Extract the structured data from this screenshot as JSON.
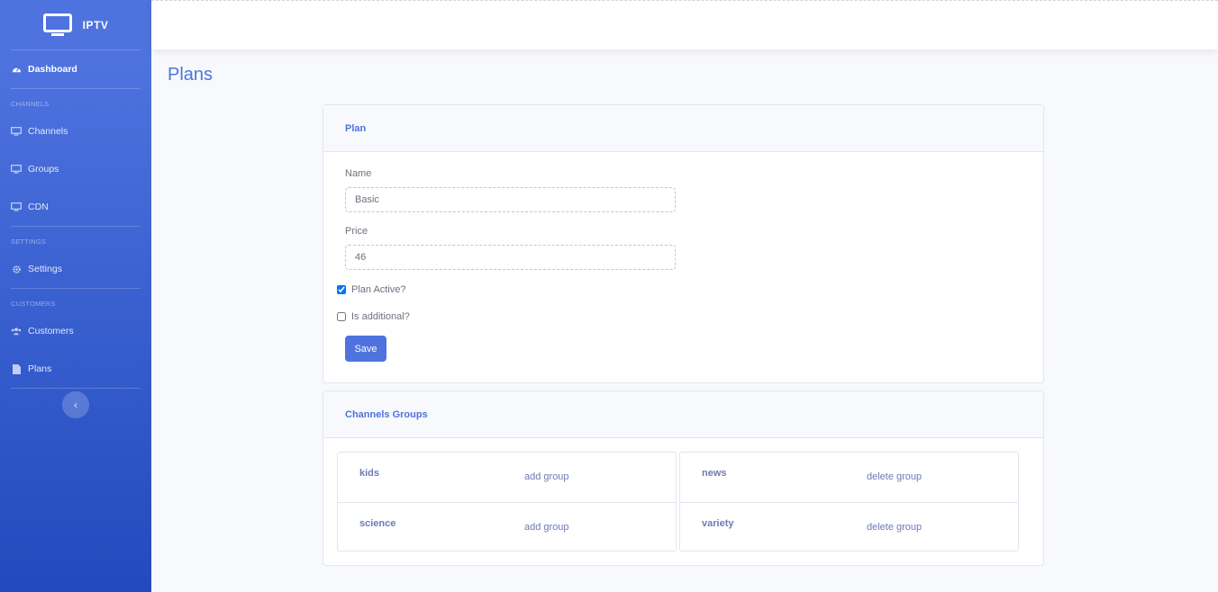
{
  "sidebar": {
    "brand": "IPTV",
    "dashboard": "Dashboard",
    "heading_channels": "CHANNELS",
    "channels": "Channels",
    "groups": "Groups",
    "cdn": "CDN",
    "heading_settings": "SETTINGS",
    "settings": "Settings",
    "heading_customers": "CUSTOMERS",
    "customers": "Customers",
    "plans": "Plans",
    "toggle": "‹"
  },
  "page": {
    "title": "Plans"
  },
  "plan_card": {
    "header": "Plan",
    "name_label": "Name",
    "name_value": "Basic",
    "price_label": "Price",
    "price_value": "46",
    "active_label": "Plan Active?",
    "active_checked": true,
    "additional_label": "Is additional?",
    "additional_checked": false,
    "save_label": "Save"
  },
  "groups_card": {
    "header": "Channels Groups",
    "available": [
      {
        "name": "kids",
        "action": "add group"
      },
      {
        "name": "science",
        "action": "add group"
      }
    ],
    "assigned": [
      {
        "name": "news",
        "action": "delete group"
      },
      {
        "name": "variety",
        "action": "delete group"
      }
    ]
  },
  "colors": {
    "primary": "#4e73df",
    "sidebar_end": "#224abe"
  }
}
